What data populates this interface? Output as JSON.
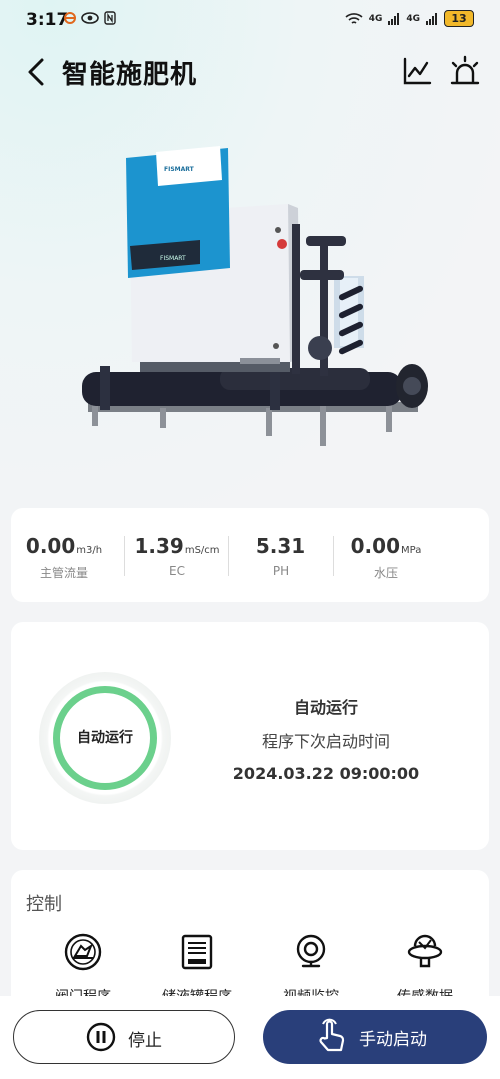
{
  "status_bar": {
    "time": "3:17",
    "signal_1": "4G",
    "signal_2": "4G",
    "battery": "13"
  },
  "header": {
    "title": "智能施肥机",
    "icons": [
      "back-icon",
      "chart-icon",
      "alarm-icon"
    ]
  },
  "machine": {
    "brand_top": "FISMART",
    "brand_panel": "FISMART"
  },
  "metrics": [
    {
      "value": "0.00",
      "unit": "m3/h",
      "label": "主管流量"
    },
    {
      "value": "1.39",
      "unit": "mS/cm",
      "label": "EC"
    },
    {
      "value": "5.31",
      "unit": "",
      "label": "PH"
    },
    {
      "value": "0.00",
      "unit": "MPa",
      "label": "水压"
    }
  ],
  "run_status": {
    "ring_label": "自动运行",
    "title": "自动运行",
    "subtitle": "程序下次启动时间",
    "next_time": "2024.03.22 09:00:00",
    "ring_color": "#6bd08c"
  },
  "control": {
    "title": "控制",
    "items": [
      {
        "label": "阀门程序",
        "icon": "valve-program-icon"
      },
      {
        "label": "储液罐程序",
        "icon": "tank-program-icon"
      },
      {
        "label": "视频监控",
        "icon": "camera-icon"
      },
      {
        "label": "传感数据",
        "icon": "sensor-icon"
      }
    ]
  },
  "actions": {
    "stop_label": "停止",
    "manual_label": "手动启动",
    "primary_color": "#293f7a"
  }
}
